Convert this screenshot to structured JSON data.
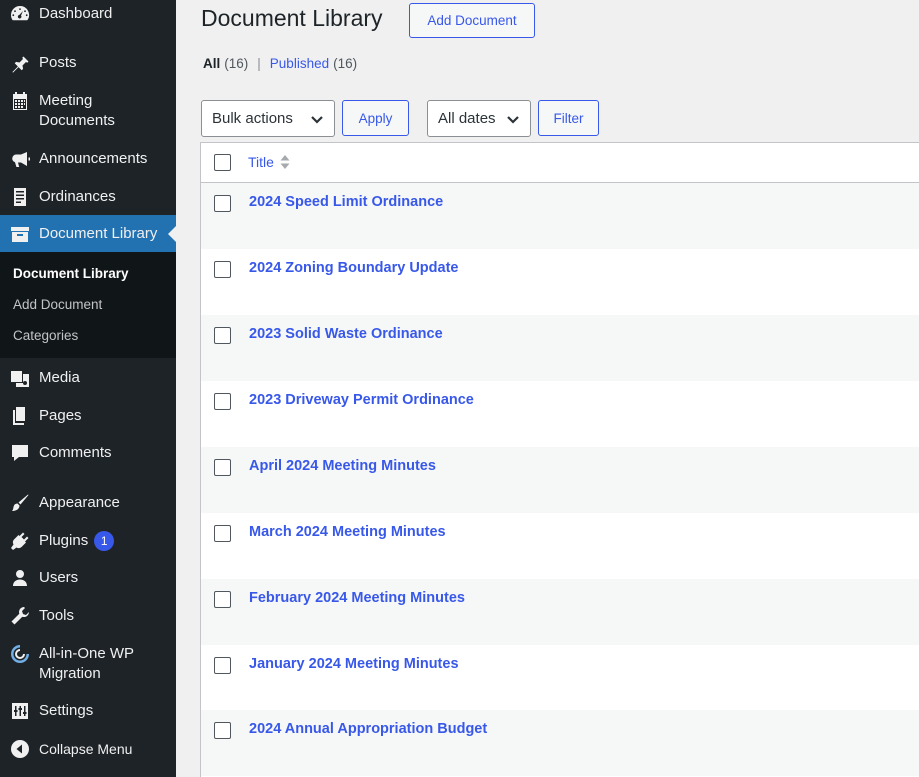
{
  "sidebar": {
    "items": [
      {
        "label": "Dashboard",
        "icon": "dashboard-icon"
      },
      {
        "label": "Posts",
        "icon": "pin-icon"
      },
      {
        "label": "Meeting Documents",
        "icon": "calendar-icon"
      },
      {
        "label": "Announcements",
        "icon": "megaphone-icon"
      },
      {
        "label": "Ordinances",
        "icon": "document-icon"
      },
      {
        "label": "Document Library",
        "icon": "archive-icon"
      },
      {
        "label": "Media",
        "icon": "media-icon"
      },
      {
        "label": "Pages",
        "icon": "pages-icon"
      },
      {
        "label": "Comments",
        "icon": "comment-icon"
      },
      {
        "label": "Appearance",
        "icon": "brush-icon"
      },
      {
        "label": "Plugins",
        "icon": "plugin-icon",
        "badge": "1"
      },
      {
        "label": "Users",
        "icon": "user-icon"
      },
      {
        "label": "Tools",
        "icon": "wrench-icon"
      },
      {
        "label": "All-in-One WP Migration",
        "icon": "migration-icon"
      },
      {
        "label": "Settings",
        "icon": "settings-icon"
      },
      {
        "label": "Collapse Menu",
        "icon": "collapse-icon"
      }
    ],
    "submenu": [
      {
        "label": "Document Library"
      },
      {
        "label": "Add Document"
      },
      {
        "label": "Categories"
      }
    ]
  },
  "header": {
    "title": "Document Library",
    "add_button": "Add Document"
  },
  "filters": {
    "all_label": "All",
    "all_count": "(16)",
    "separator": "|",
    "published_label": "Published",
    "published_count": "(16)"
  },
  "toolbar": {
    "bulk_actions": "Bulk actions",
    "apply": "Apply",
    "dates": "All dates",
    "filter": "Filter"
  },
  "table": {
    "column_title": "Title",
    "rows": [
      "2024 Speed Limit Ordinance",
      "2024 Zoning Boundary Update",
      "2023 Solid Waste Ordinance",
      "2023 Driveway Permit Ordinance",
      "April 2024 Meeting Minutes",
      "March 2024 Meeting Minutes",
      "February 2024 Meeting Minutes",
      "January 2024 Meeting Minutes",
      "2024 Annual Appropriation Budget"
    ]
  },
  "colors": {
    "sidebar_bg": "#1d2327",
    "submenu_bg": "#101517",
    "accent": "#3858e9",
    "current_menu": "#2271b1"
  }
}
